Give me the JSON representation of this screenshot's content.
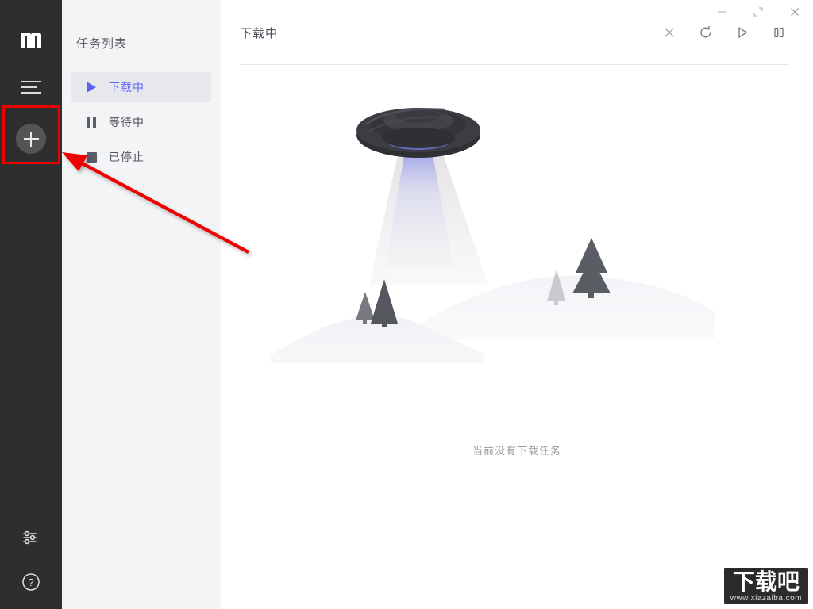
{
  "window": {
    "title": "Motrix",
    "controls": [
      {
        "name": "minimize",
        "glyph": "minimize-icon",
        "label": "最小化"
      },
      {
        "name": "maximize",
        "glyph": "maximize-icon",
        "label": "最大化"
      },
      {
        "name": "close",
        "glyph": "close-icon",
        "label": "关闭"
      }
    ]
  },
  "rail": {
    "logo_alt": "motrix-logo",
    "buttons": [
      {
        "name": "menu",
        "icon": "hamburger-icon",
        "label": "菜单"
      },
      {
        "name": "add-task",
        "icon": "plus-icon",
        "label": "新建任务"
      }
    ],
    "bottom_buttons": [
      {
        "name": "preferences",
        "icon": "sliders-icon",
        "label": "偏好设置"
      },
      {
        "name": "help",
        "icon": "question-circle-icon",
        "label": "帮助"
      }
    ]
  },
  "tasklist": {
    "title": "任务列表",
    "items": [
      {
        "label": "下载中",
        "icon": "play-icon",
        "active": true
      },
      {
        "label": "等待中",
        "icon": "pause-icon",
        "active": false
      },
      {
        "label": "已停止",
        "icon": "stop-icon",
        "active": false
      }
    ]
  },
  "main": {
    "title": "下载中",
    "toolbar": [
      {
        "name": "delete",
        "icon": "close-x-icon",
        "label": "删除"
      },
      {
        "name": "retry",
        "icon": "refresh-icon",
        "label": "重试"
      },
      {
        "name": "resume",
        "icon": "play-outline-icon",
        "label": "开始"
      },
      {
        "name": "pause",
        "icon": "pause-outline-icon",
        "label": "暂停"
      }
    ],
    "empty_state": {
      "illustration": "ufo-abduction-illustration",
      "text": "当前没有下载任务"
    }
  },
  "annotation": {
    "highlight_target": "add-task-button",
    "arrow_color": "#ef0000",
    "box_color": "#ef0000"
  },
  "watermark": {
    "main": "下载吧",
    "sub": "www.xiazaiba.com"
  },
  "colors": {
    "rail_bg": "#2e2e2e",
    "tasklist_bg": "#f3f4f6",
    "main_bg": "#ffffff",
    "accent": "#6266f0",
    "active_item_bg": "#e6e8ec",
    "text_primary": "#4a4d55",
    "text_muted": "#9a9ca2"
  }
}
